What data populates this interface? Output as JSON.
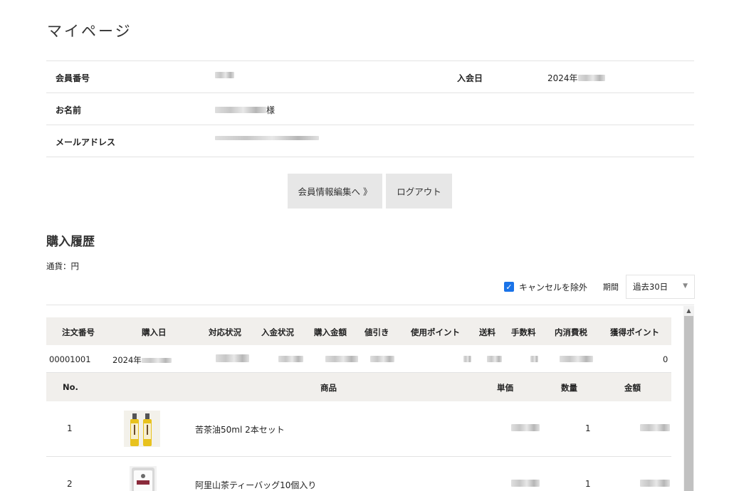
{
  "page": {
    "title": "マイページ"
  },
  "profile": {
    "member_no_label": "会員番号",
    "join_date_label": "入会日",
    "join_date_value": "2024年",
    "name_label": "お名前",
    "name_suffix": "様",
    "email_label": "メールアドレス"
  },
  "buttons": {
    "edit": "会員情報編集へ 》",
    "logout": "ログアウト"
  },
  "history": {
    "title": "購入履歴",
    "currency": "通貨：円",
    "exclude_cancel_label": "キャンセルを除外",
    "exclude_cancel_checked": true,
    "period_label": "期間",
    "period_value": "過去30日"
  },
  "orders_table": {
    "headers": [
      "注文番号",
      "購入日",
      "対応状況",
      "入金状況",
      "購入金額",
      "値引き",
      "使用ポイント",
      "送料",
      "手数料",
      "内消費税",
      "獲得ポイント"
    ],
    "rows": [
      {
        "order_no": "00001001",
        "date": "2024年",
        "earned_points": "0"
      }
    ]
  },
  "items_table": {
    "headers": [
      "No.",
      "商品",
      "単価",
      "数量",
      "金額"
    ],
    "rows": [
      {
        "no": "1",
        "product": "苦茶油50ml 2本セット",
        "qty": "1",
        "image": "oil-bottles-image"
      },
      {
        "no": "2",
        "product": "阿里山茶ティーバッグ10個入り",
        "qty": "1",
        "image": "tea-bag-package-image"
      }
    ]
  },
  "icons": {
    "checkbox": "checkmark-icon",
    "select": "caret-down-icon",
    "scroll": "scroll-up-arrow-icon"
  }
}
